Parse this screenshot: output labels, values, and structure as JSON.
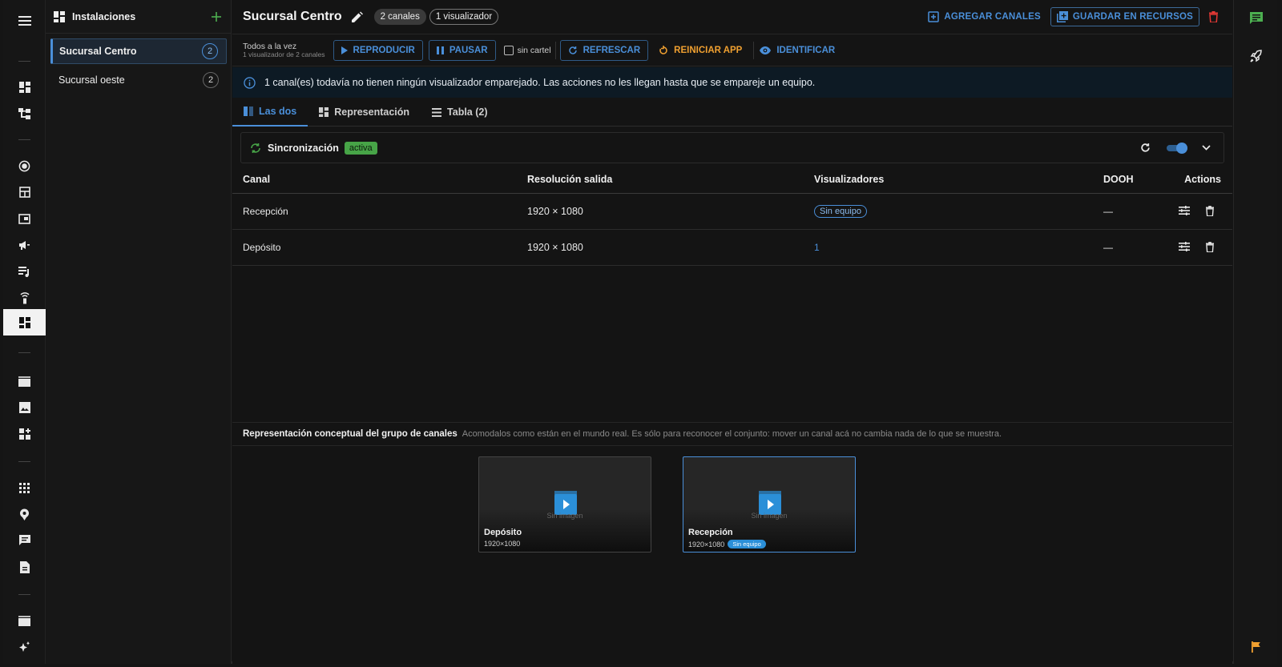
{
  "colors": {
    "accent": "#4a8fd9",
    "warning": "#f0a030",
    "success": "#47a447",
    "danger": "#e53935",
    "chat": "#4caf50"
  },
  "rail": {
    "icons": [
      "menu-icon",
      "dashboard-icon",
      "hierarchy-icon",
      "target-icon",
      "layout-icon",
      "screen-icon",
      "campaign-icon",
      "playlist-icon",
      "remote-icon",
      "installations-icon",
      "video-icon",
      "image-icon",
      "widgets-icon",
      "apps-icon",
      "location-icon",
      "messages-icon",
      "document-icon",
      "film-icon",
      "sparkle-icon"
    ]
  },
  "installations": {
    "title": "Instalaciones",
    "items": [
      {
        "name": "Sucursal Centro",
        "count": "2"
      },
      {
        "name": "Sucursal oeste",
        "count": "2"
      }
    ]
  },
  "header": {
    "title": "Sucursal Centro",
    "channels_pill": "2 canales",
    "viewers_pill": "1 visualizador",
    "add_channels": "AGREGAR CANALES",
    "save_resources": "GUARDAR EN RECURSOS"
  },
  "actions": {
    "all_at_once": "Todos a la vez",
    "all_at_once_sub": "1 visualizador de 2 canales",
    "play": "REPRODUCIR",
    "pause": "PAUSAR",
    "no_banner": "sin cartel",
    "refresh": "REFRESCAR",
    "restart": "REINICIAR APP",
    "identify": "IDENTIFICAR"
  },
  "info": "1 canal(es) todavía no tienen ningún visualizador emparejado. Las acciones no les llegan hasta que se empareje un equipo.",
  "tabs": [
    {
      "label": "Las dos"
    },
    {
      "label": "Representación"
    },
    {
      "label": "Tabla (2)"
    }
  ],
  "sync": {
    "label": "Sincronización",
    "badge": "activa"
  },
  "table": {
    "headers": [
      "Canal",
      "Resolución salida",
      "Visualizadores",
      "DOOH",
      "Actions"
    ],
    "rows": [
      {
        "canal": "Recepción",
        "resolucion": "1920 × 1080",
        "visualizadores": "Sin equipo",
        "dooh": "—"
      },
      {
        "canal": "Depósito",
        "resolucion": "1920 × 1080",
        "visualizadores": "1",
        "dooh": "—"
      }
    ]
  },
  "concept": {
    "title": "Representación conceptual del grupo de canales",
    "subtitle": "Acomodalos como están en el mundo real. Es sólo para reconocer el conjunto: mover un canal acá no cambia nada de lo que se muestra."
  },
  "cards": [
    {
      "name": "Depósito",
      "res": "1920×1080",
      "placeholder": "Sin imagen"
    },
    {
      "name": "Recepción",
      "res": "1920×1080",
      "placeholder": "Sin imagen",
      "chip": "Sin equipo"
    }
  ]
}
